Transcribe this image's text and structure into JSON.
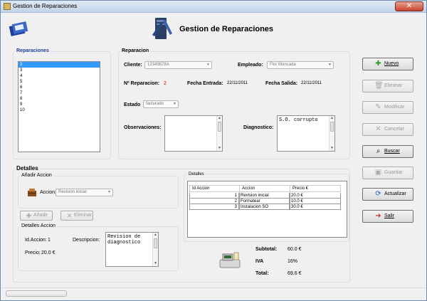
{
  "window": {
    "title": "Gestion de Reparaciones",
    "close_glyph": "✕"
  },
  "header": {
    "title": "Gestion de Reparaciones"
  },
  "reparaciones": {
    "title": "Reparaciones",
    "items": [
      "2",
      "3",
      "4",
      "5",
      "6",
      "7",
      "8",
      "9",
      "10"
    ],
    "selected": "2"
  },
  "reparacion": {
    "title": "Reparacion",
    "cliente_label": "Cliente:",
    "cliente_value": "12345678A",
    "empleado_label": "Empleado:",
    "empleado_value": "Flor Moncada",
    "num_label": "Nº Reparacion:",
    "num_value": "2",
    "fecha_entrada_label": "Fecha Entrada:",
    "fecha_entrada_value": "22/11/2011",
    "fecha_salida_label": "Fecha Salida:",
    "fecha_salida_value": "22/11/2011",
    "estado_label": "Estado",
    "estado_value": "facturado",
    "observaciones_label": "Observaciones:",
    "observaciones_value": "",
    "diagnostico_label": "Diagnostico:",
    "diagnostico_value": "S.O. corrupto"
  },
  "detalles": {
    "title": "Detalles",
    "anadir_group_title": "Añadir Accion",
    "accion_label": "Accion:",
    "accion_value": "Revision inicial",
    "anadir_button": "Añadir",
    "eliminar_button": "Eliminar",
    "detalles_accion_title": "Detalles Accion",
    "id_accion_label": "Id.Accion:",
    "id_accion_value": "1",
    "descripcion_label": "Descripcion:",
    "descripcion_value": "Revision de diagnostico",
    "precio_label": "Precio:",
    "precio_value": "20.0 €",
    "table_title": "Detalles",
    "columns": [
      "Id Accion",
      "Accion",
      "Precio €"
    ],
    "rows": [
      {
        "id": "1",
        "accion": "Revision inicial",
        "precio": "20.0 €"
      },
      {
        "id": "2",
        "accion": "Formatear",
        "precio": "10.0 €"
      },
      {
        "id": "3",
        "accion": "Instalacion SO",
        "precio": "30.0 €"
      }
    ],
    "subtotal_label": "Subtotal:",
    "subtotal_value": "60.0 €",
    "iva_label": "IVA",
    "iva_value": "16%",
    "total_label": "Total:",
    "total_value": "69.6 €"
  },
  "buttons": {
    "nuevo": "Nuevo",
    "eliminar": "Eliminar",
    "modificar": "Modificar",
    "cancelar": "Cancelar",
    "buscar": "Buscar",
    "guardar": "Guardar",
    "actualizar": "Actualizar",
    "salir": "Salir"
  },
  "colors": {
    "accent": "#3399ff",
    "title_blue": "#1f3d9a",
    "red_value": "#cc0000"
  }
}
